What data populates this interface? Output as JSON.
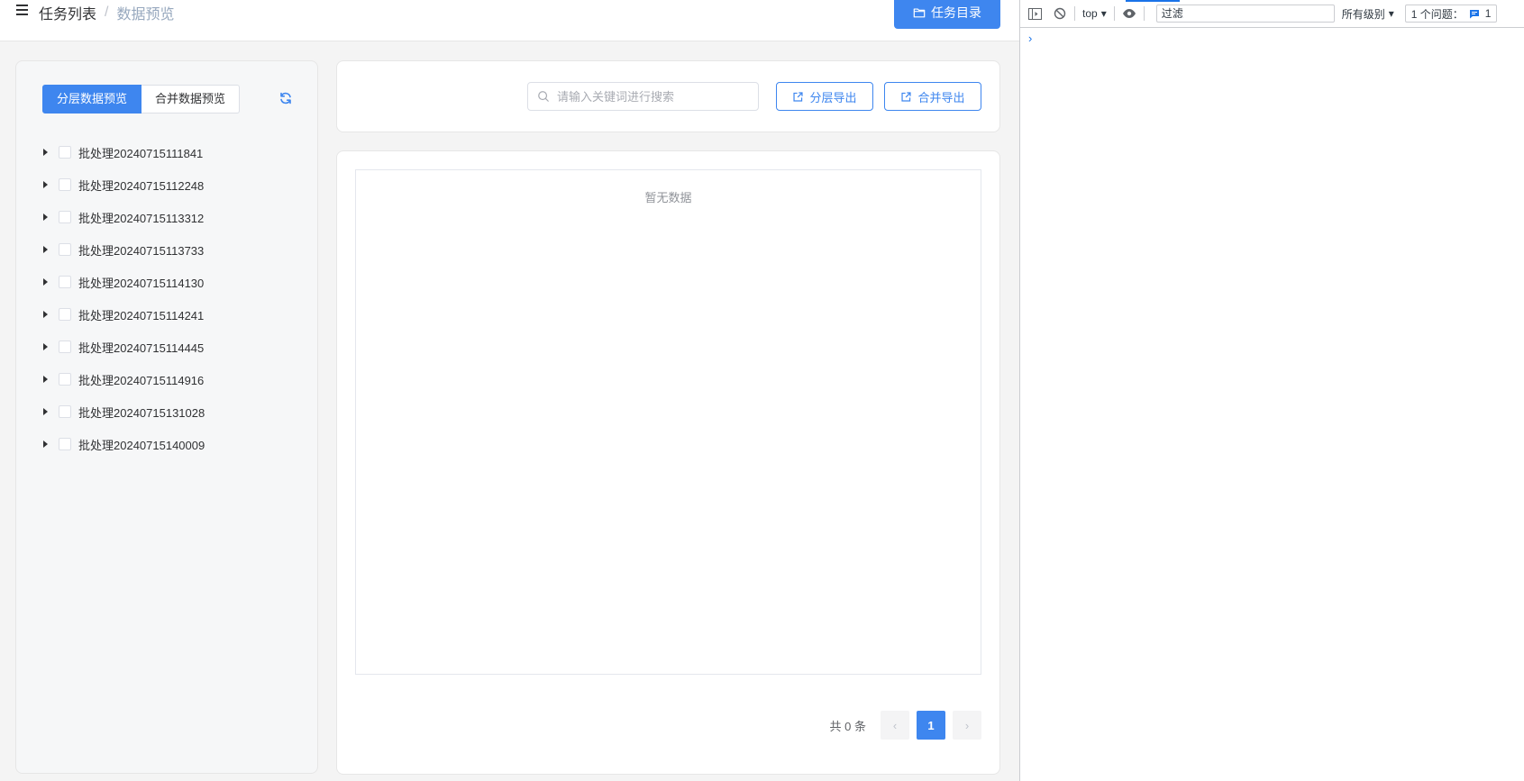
{
  "header": {
    "breadcrumb": [
      "任务列表",
      "/",
      "数据预览"
    ],
    "task_dir_button": "任务目录"
  },
  "sidebar": {
    "tabs": [
      "分层数据预览",
      "合并数据预览"
    ],
    "active_tab": 0,
    "tree": [
      "批处理20240715111841",
      "批处理20240715112248",
      "批处理20240715113312",
      "批处理20240715113733",
      "批处理20240715114130",
      "批处理20240715114241",
      "批处理20240715114445",
      "批处理20240715114916",
      "批处理20240715131028",
      "批处理20240715140009"
    ]
  },
  "toolbar": {
    "search_placeholder": "请输入关键词进行搜索",
    "layer_export": "分层导出",
    "merge_export": "合并导出"
  },
  "table": {
    "empty_text": "暂无数据"
  },
  "pagination": {
    "total_text": "共 0 条",
    "current_page": "1",
    "prev": "‹",
    "next": "›"
  },
  "devtools": {
    "context": "top",
    "filter_value": "过滤",
    "levels": "所有级别",
    "issues_label": "1 个问题：",
    "issues_count": "1",
    "prompt": "›"
  },
  "colors": {
    "primary": "#3e86ef",
    "devtools_accent": "#1a73e8"
  }
}
